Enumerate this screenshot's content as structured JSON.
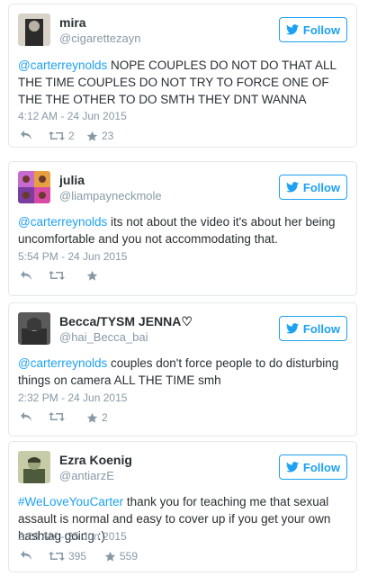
{
  "tweets": [
    {
      "name": "mira",
      "handle": "@cigarettezayn",
      "follow_label": "Follow",
      "mention": "@carterreynolds",
      "text": " NOPE COUPLES DO NOT DO THAT ALL THE TIME COUPLES DO NOT TRY TO FORCE ONE OF THE THE OTHER TO DO SMTH THEY DNT WANNA",
      "timestamp": "4:12 AM - 24 Jun 2015",
      "retweets": "2",
      "likes": "23",
      "avatar_colors": [
        "#2b2b2b",
        "#b9b1a6"
      ]
    },
    {
      "name": "julia",
      "handle": "@liampayneckmole",
      "follow_label": "Follow",
      "mention": "@carterreynolds",
      "text": " its not about the video it's about her being uncomfortable and you not accommodating that.",
      "timestamp": "5:54 PM - 24 Jun 2015",
      "retweets": "",
      "likes": "",
      "avatar_colors": [
        "#c86bd1",
        "#7a3ea0"
      ]
    },
    {
      "name": "Becca/TYSM JENNA♡",
      "handle": "@hai_Becca_bai",
      "follow_label": "Follow",
      "mention": "@carterreynolds",
      "text": " couples don't force people to do disturbing things on camera ALL THE TIME smh",
      "timestamp": "2:32 PM - 24 Jun 2015",
      "retweets": "",
      "likes": "2",
      "avatar_colors": [
        "#3a3a3a",
        "#8a8a8a"
      ]
    },
    {
      "name": "Ezra Koenig",
      "handle": "@antiarzE",
      "follow_label": "Follow",
      "mention": "#WeLoveYouCarter",
      "text": " thank you for teaching me that sexual assault is normal and easy to cover up if you get your own hashtag going :)",
      "timestamp": "2:26 AM - 25 Jun 2015",
      "retweets": "395",
      "likes": "559",
      "avatar_colors": [
        "#4e5a3c",
        "#9aa37a"
      ]
    }
  ],
  "colors": {
    "accent": "#1da1f2",
    "muted": "#8899a6",
    "border": "#e1e8ed"
  },
  "icons": [
    "reply-icon",
    "retweet-icon",
    "like-star-icon",
    "twitter-bird-icon"
  ]
}
